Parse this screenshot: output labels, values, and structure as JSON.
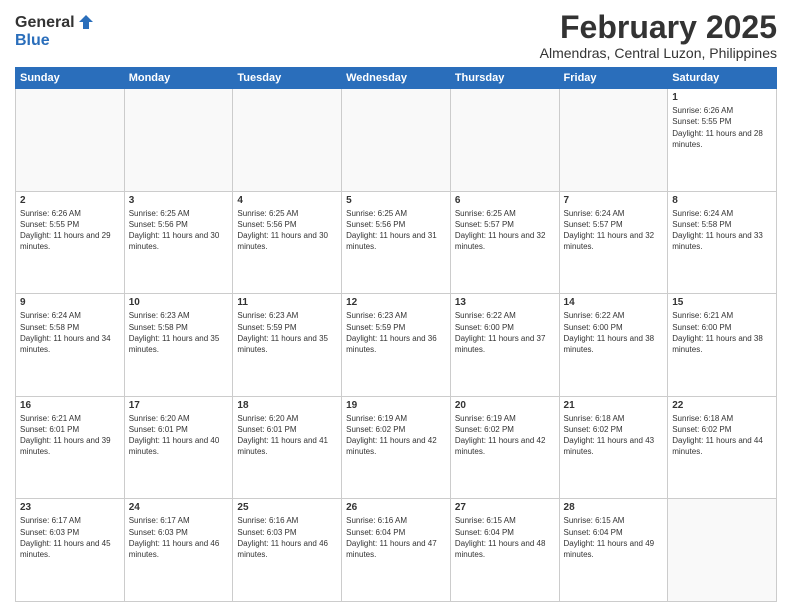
{
  "logo": {
    "general": "General",
    "blue": "Blue"
  },
  "title": "February 2025",
  "subtitle": "Almendras, Central Luzon, Philippines",
  "days_header": [
    "Sunday",
    "Monday",
    "Tuesday",
    "Wednesday",
    "Thursday",
    "Friday",
    "Saturday"
  ],
  "weeks": [
    [
      {
        "num": "",
        "info": ""
      },
      {
        "num": "",
        "info": ""
      },
      {
        "num": "",
        "info": ""
      },
      {
        "num": "",
        "info": ""
      },
      {
        "num": "",
        "info": ""
      },
      {
        "num": "",
        "info": ""
      },
      {
        "num": "1",
        "info": "Sunrise: 6:26 AM\nSunset: 5:55 PM\nDaylight: 11 hours and 28 minutes."
      }
    ],
    [
      {
        "num": "2",
        "info": "Sunrise: 6:26 AM\nSunset: 5:55 PM\nDaylight: 11 hours and 29 minutes."
      },
      {
        "num": "3",
        "info": "Sunrise: 6:25 AM\nSunset: 5:56 PM\nDaylight: 11 hours and 30 minutes."
      },
      {
        "num": "4",
        "info": "Sunrise: 6:25 AM\nSunset: 5:56 PM\nDaylight: 11 hours and 30 minutes."
      },
      {
        "num": "5",
        "info": "Sunrise: 6:25 AM\nSunset: 5:56 PM\nDaylight: 11 hours and 31 minutes."
      },
      {
        "num": "6",
        "info": "Sunrise: 6:25 AM\nSunset: 5:57 PM\nDaylight: 11 hours and 32 minutes."
      },
      {
        "num": "7",
        "info": "Sunrise: 6:24 AM\nSunset: 5:57 PM\nDaylight: 11 hours and 32 minutes."
      },
      {
        "num": "8",
        "info": "Sunrise: 6:24 AM\nSunset: 5:58 PM\nDaylight: 11 hours and 33 minutes."
      }
    ],
    [
      {
        "num": "9",
        "info": "Sunrise: 6:24 AM\nSunset: 5:58 PM\nDaylight: 11 hours and 34 minutes."
      },
      {
        "num": "10",
        "info": "Sunrise: 6:23 AM\nSunset: 5:58 PM\nDaylight: 11 hours and 35 minutes."
      },
      {
        "num": "11",
        "info": "Sunrise: 6:23 AM\nSunset: 5:59 PM\nDaylight: 11 hours and 35 minutes."
      },
      {
        "num": "12",
        "info": "Sunrise: 6:23 AM\nSunset: 5:59 PM\nDaylight: 11 hours and 36 minutes."
      },
      {
        "num": "13",
        "info": "Sunrise: 6:22 AM\nSunset: 6:00 PM\nDaylight: 11 hours and 37 minutes."
      },
      {
        "num": "14",
        "info": "Sunrise: 6:22 AM\nSunset: 6:00 PM\nDaylight: 11 hours and 38 minutes."
      },
      {
        "num": "15",
        "info": "Sunrise: 6:21 AM\nSunset: 6:00 PM\nDaylight: 11 hours and 38 minutes."
      }
    ],
    [
      {
        "num": "16",
        "info": "Sunrise: 6:21 AM\nSunset: 6:01 PM\nDaylight: 11 hours and 39 minutes."
      },
      {
        "num": "17",
        "info": "Sunrise: 6:20 AM\nSunset: 6:01 PM\nDaylight: 11 hours and 40 minutes."
      },
      {
        "num": "18",
        "info": "Sunrise: 6:20 AM\nSunset: 6:01 PM\nDaylight: 11 hours and 41 minutes."
      },
      {
        "num": "19",
        "info": "Sunrise: 6:19 AM\nSunset: 6:02 PM\nDaylight: 11 hours and 42 minutes."
      },
      {
        "num": "20",
        "info": "Sunrise: 6:19 AM\nSunset: 6:02 PM\nDaylight: 11 hours and 42 minutes."
      },
      {
        "num": "21",
        "info": "Sunrise: 6:18 AM\nSunset: 6:02 PM\nDaylight: 11 hours and 43 minutes."
      },
      {
        "num": "22",
        "info": "Sunrise: 6:18 AM\nSunset: 6:02 PM\nDaylight: 11 hours and 44 minutes."
      }
    ],
    [
      {
        "num": "23",
        "info": "Sunrise: 6:17 AM\nSunset: 6:03 PM\nDaylight: 11 hours and 45 minutes."
      },
      {
        "num": "24",
        "info": "Sunrise: 6:17 AM\nSunset: 6:03 PM\nDaylight: 11 hours and 46 minutes."
      },
      {
        "num": "25",
        "info": "Sunrise: 6:16 AM\nSunset: 6:03 PM\nDaylight: 11 hours and 46 minutes."
      },
      {
        "num": "26",
        "info": "Sunrise: 6:16 AM\nSunset: 6:04 PM\nDaylight: 11 hours and 47 minutes."
      },
      {
        "num": "27",
        "info": "Sunrise: 6:15 AM\nSunset: 6:04 PM\nDaylight: 11 hours and 48 minutes."
      },
      {
        "num": "28",
        "info": "Sunrise: 6:15 AM\nSunset: 6:04 PM\nDaylight: 11 hours and 49 minutes."
      },
      {
        "num": "",
        "info": ""
      }
    ]
  ]
}
